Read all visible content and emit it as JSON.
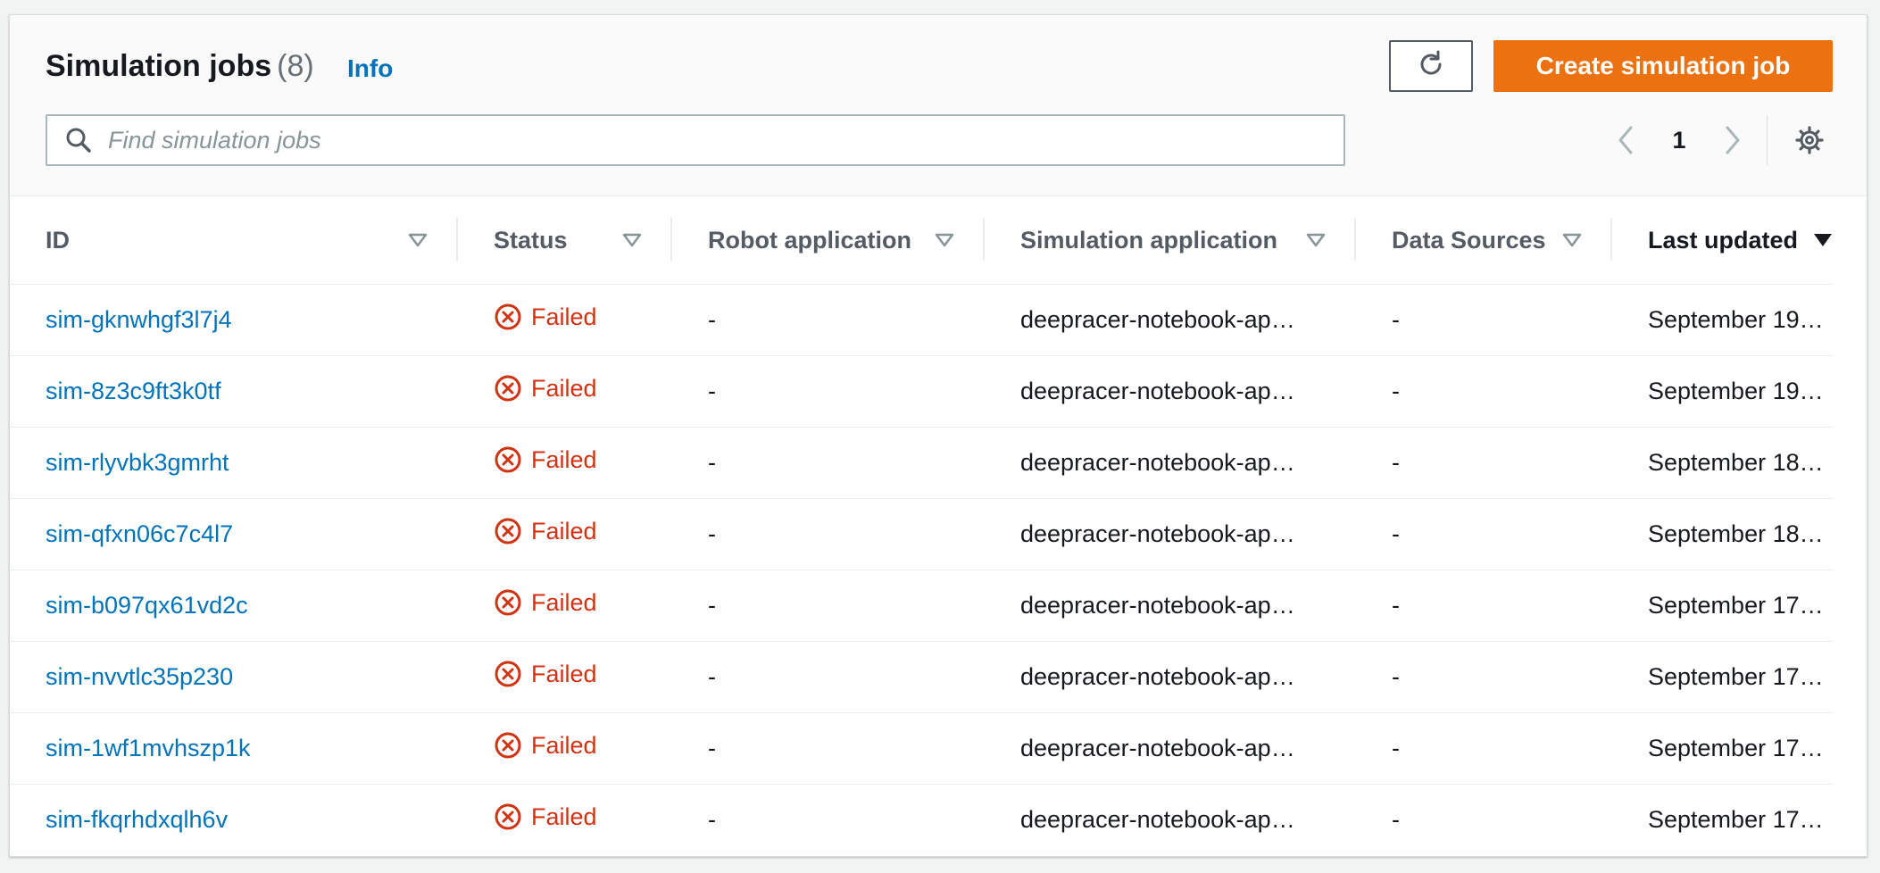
{
  "header": {
    "title": "Simulation jobs",
    "count": "(8)",
    "info_label": "Info",
    "create_label": "Create simulation job"
  },
  "search": {
    "placeholder": "Find simulation jobs"
  },
  "pagination": {
    "current_page": "1"
  },
  "icons": {
    "refresh": "refresh-icon",
    "search": "search-icon",
    "prev": "chevron-left-icon",
    "next": "chevron-right-icon",
    "settings": "gear-icon",
    "status": "error-circle-icon",
    "sort": "caret-down-icon"
  },
  "colors": {
    "accent": "#ec7211",
    "link": "#0073bb",
    "error": "#d13212"
  },
  "table": {
    "columns": [
      "ID",
      "Status",
      "Robot application",
      "Simulation application",
      "Data Sources",
      "Last updated"
    ],
    "sorted_column": "Last updated",
    "rows": [
      {
        "id": "sim-gknwhgf3l7j4",
        "status": "Failed",
        "robot_app": "-",
        "sim_app": "deepracer-notebook-ap…",
        "data_sources": "-",
        "last_updated": "September 19…"
      },
      {
        "id": "sim-8z3c9ft3k0tf",
        "status": "Failed",
        "robot_app": "-",
        "sim_app": "deepracer-notebook-ap…",
        "data_sources": "-",
        "last_updated": "September 19…"
      },
      {
        "id": "sim-rlyvbk3gmrht",
        "status": "Failed",
        "robot_app": "-",
        "sim_app": "deepracer-notebook-ap…",
        "data_sources": "-",
        "last_updated": "September 18…"
      },
      {
        "id": "sim-qfxn06c7c4l7",
        "status": "Failed",
        "robot_app": "-",
        "sim_app": "deepracer-notebook-ap…",
        "data_sources": "-",
        "last_updated": "September 18…"
      },
      {
        "id": "sim-b097qx61vd2c",
        "status": "Failed",
        "robot_app": "-",
        "sim_app": "deepracer-notebook-ap…",
        "data_sources": "-",
        "last_updated": "September 17…"
      },
      {
        "id": "sim-nvvtlc35p230",
        "status": "Failed",
        "robot_app": "-",
        "sim_app": "deepracer-notebook-ap…",
        "data_sources": "-",
        "last_updated": "September 17…"
      },
      {
        "id": "sim-1wf1mvhszp1k",
        "status": "Failed",
        "robot_app": "-",
        "sim_app": "deepracer-notebook-ap…",
        "data_sources": "-",
        "last_updated": "September 17…"
      },
      {
        "id": "sim-fkqrhdxqlh6v",
        "status": "Failed",
        "robot_app": "-",
        "sim_app": "deepracer-notebook-ap…",
        "data_sources": "-",
        "last_updated": "September 17…"
      }
    ]
  }
}
